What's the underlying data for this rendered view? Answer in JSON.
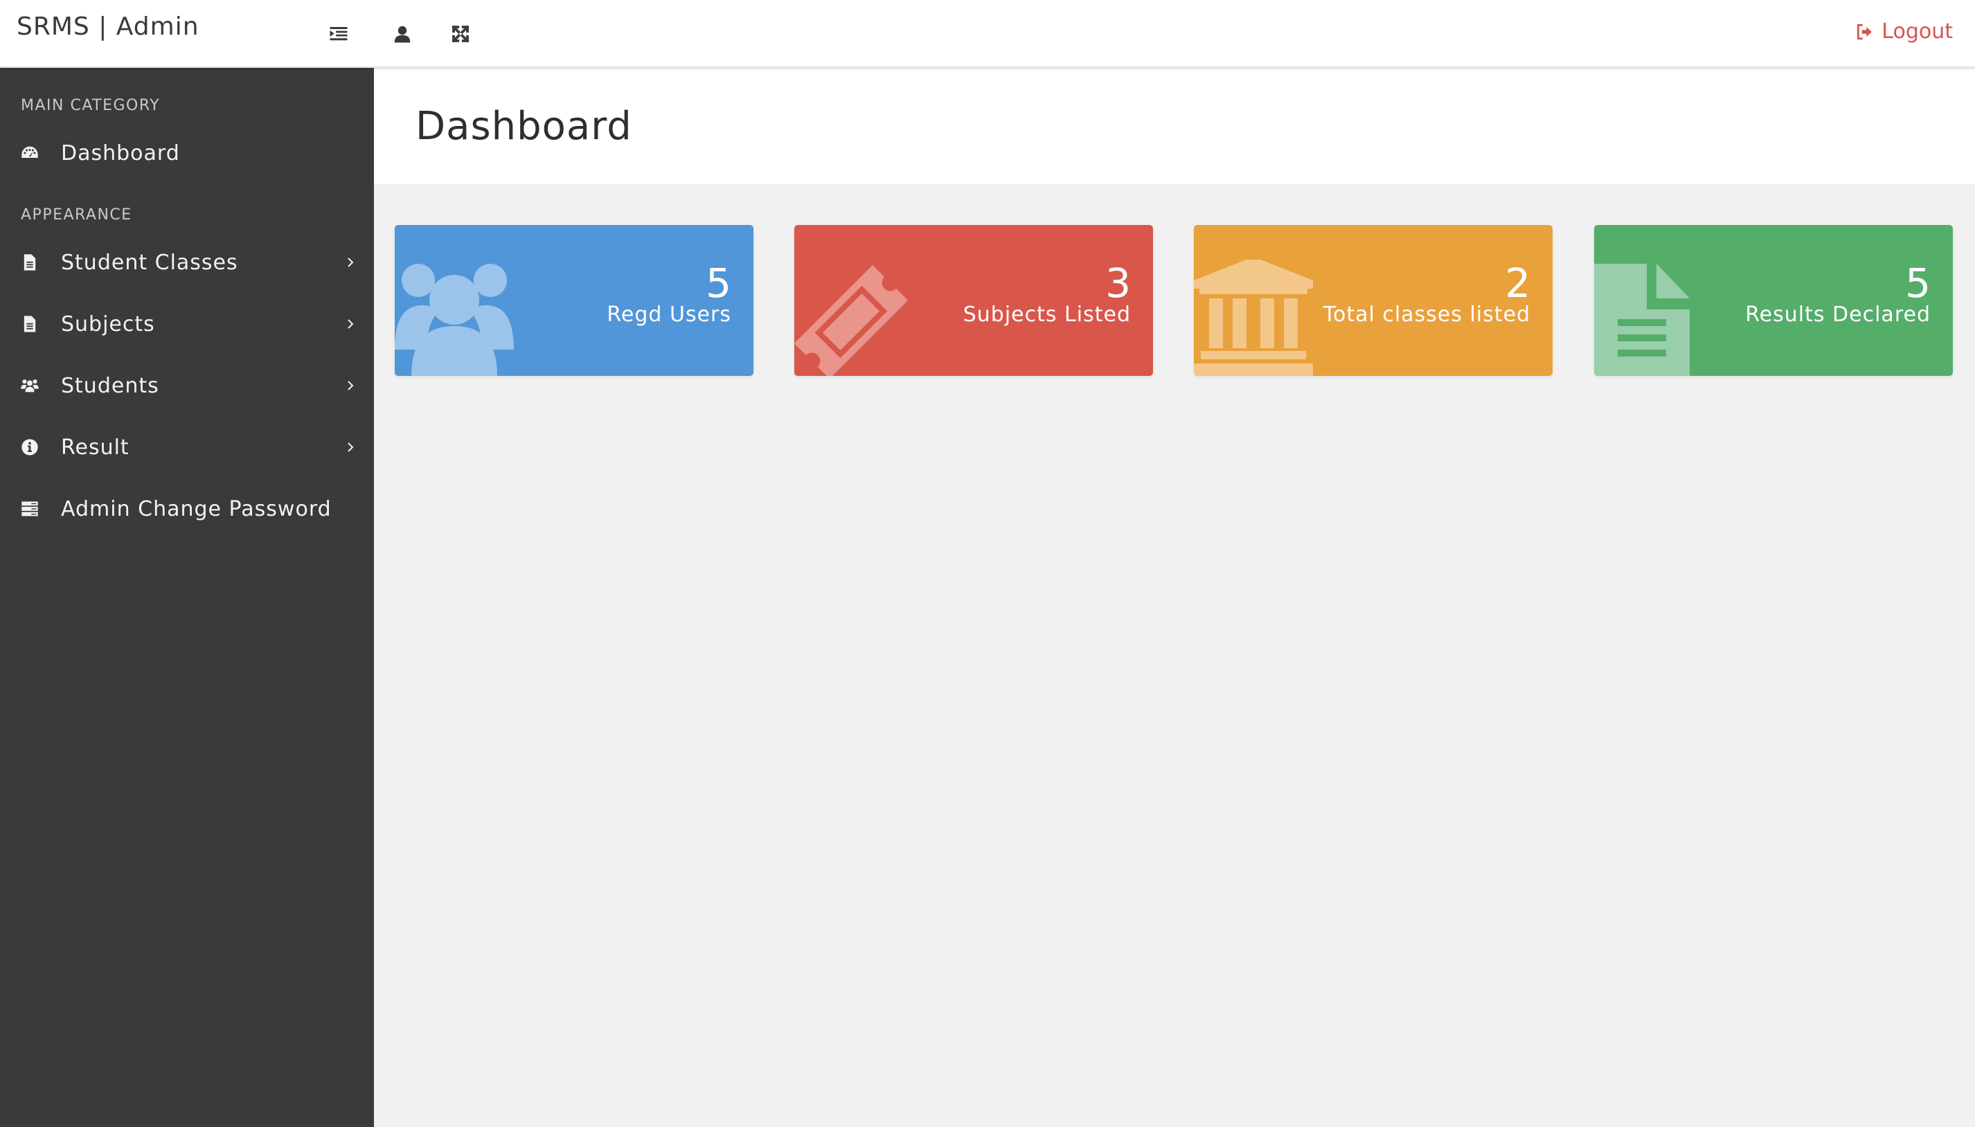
{
  "app": {
    "brand": "SRMS | Admin"
  },
  "topbar": {
    "icons": [
      "menu-toggle-icon",
      "user-icon",
      "fullscreen-icon"
    ],
    "logout_label": "Logout",
    "logout_color": "#d9534f"
  },
  "sidebar": {
    "sections": [
      {
        "label": "MAIN CATEGORY"
      },
      {
        "label": "APPEARANCE"
      }
    ],
    "items": [
      {
        "label": "Dashboard",
        "icon": "dashboard-icon",
        "has_submenu": false
      },
      {
        "label": "Student Classes",
        "icon": "file-icon",
        "has_submenu": true
      },
      {
        "label": "Subjects",
        "icon": "file-icon",
        "has_submenu": true
      },
      {
        "label": "Students",
        "icon": "users-icon",
        "has_submenu": true
      },
      {
        "label": "Result",
        "icon": "info-icon",
        "has_submenu": true
      },
      {
        "label": "Admin Change Password",
        "icon": "server-icon",
        "has_submenu": false
      }
    ]
  },
  "main": {
    "title": "Dashboard",
    "cards": [
      {
        "value": "5",
        "label": "Regd Users",
        "color": "#5196d8",
        "icon": "users-icon"
      },
      {
        "value": "3",
        "label": "Subjects Listed",
        "color": "#d9574a",
        "icon": "ticket-icon"
      },
      {
        "value": "2",
        "label": "Total classes listed",
        "color": "#e9a13c",
        "icon": "bank-icon"
      },
      {
        "value": "5",
        "label": "Results Declared",
        "color": "#55ad6a",
        "icon": "document-icon"
      }
    ]
  }
}
